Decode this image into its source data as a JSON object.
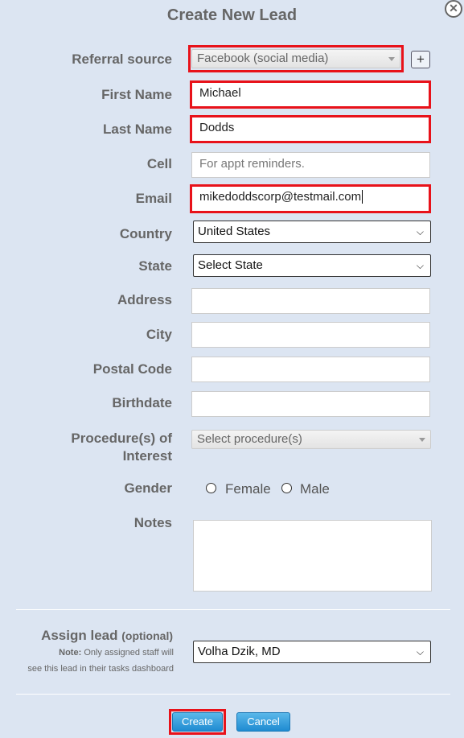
{
  "dialog": {
    "title": "Create New Lead",
    "close_icon": "close-icon"
  },
  "fields": {
    "referral_source": {
      "label": "Referral source",
      "value": "Facebook (social media)"
    },
    "add_button": "+",
    "first_name": {
      "label": "First Name",
      "value": "Michael"
    },
    "last_name": {
      "label": "Last Name",
      "value": "Dodds"
    },
    "cell": {
      "label": "Cell",
      "placeholder": "For appt reminders."
    },
    "email": {
      "label": "Email",
      "value": "mikedoddscorp@testmail.com"
    },
    "country": {
      "label": "Country",
      "value": "United States"
    },
    "state": {
      "label": "State",
      "value": "Select State"
    },
    "address": {
      "label": "Address",
      "value": ""
    },
    "city": {
      "label": "City",
      "value": ""
    },
    "postal_code": {
      "label": "Postal Code",
      "value": ""
    },
    "birthdate": {
      "label": "Birthdate",
      "value": ""
    },
    "procedure": {
      "label_line1": "Procedure(s) of",
      "label_line2": "Interest",
      "placeholder": "Select procedure(s)"
    },
    "gender": {
      "label": "Gender",
      "options": [
        "Female",
        "Male"
      ]
    },
    "notes": {
      "label": "Notes",
      "value": ""
    }
  },
  "assign": {
    "label": "Assign lead",
    "optional": "(optional)",
    "note_bold": "Note:",
    "note_line1": "Only assigned staff will",
    "note_line2": "see this lead in their tasks dashboard",
    "value": "Volha Dzik, MD"
  },
  "buttons": {
    "create": "Create",
    "cancel": "Cancel"
  },
  "colors": {
    "background": "#dce5f2",
    "highlight": "#e8121a",
    "button": "#2a95d8"
  }
}
